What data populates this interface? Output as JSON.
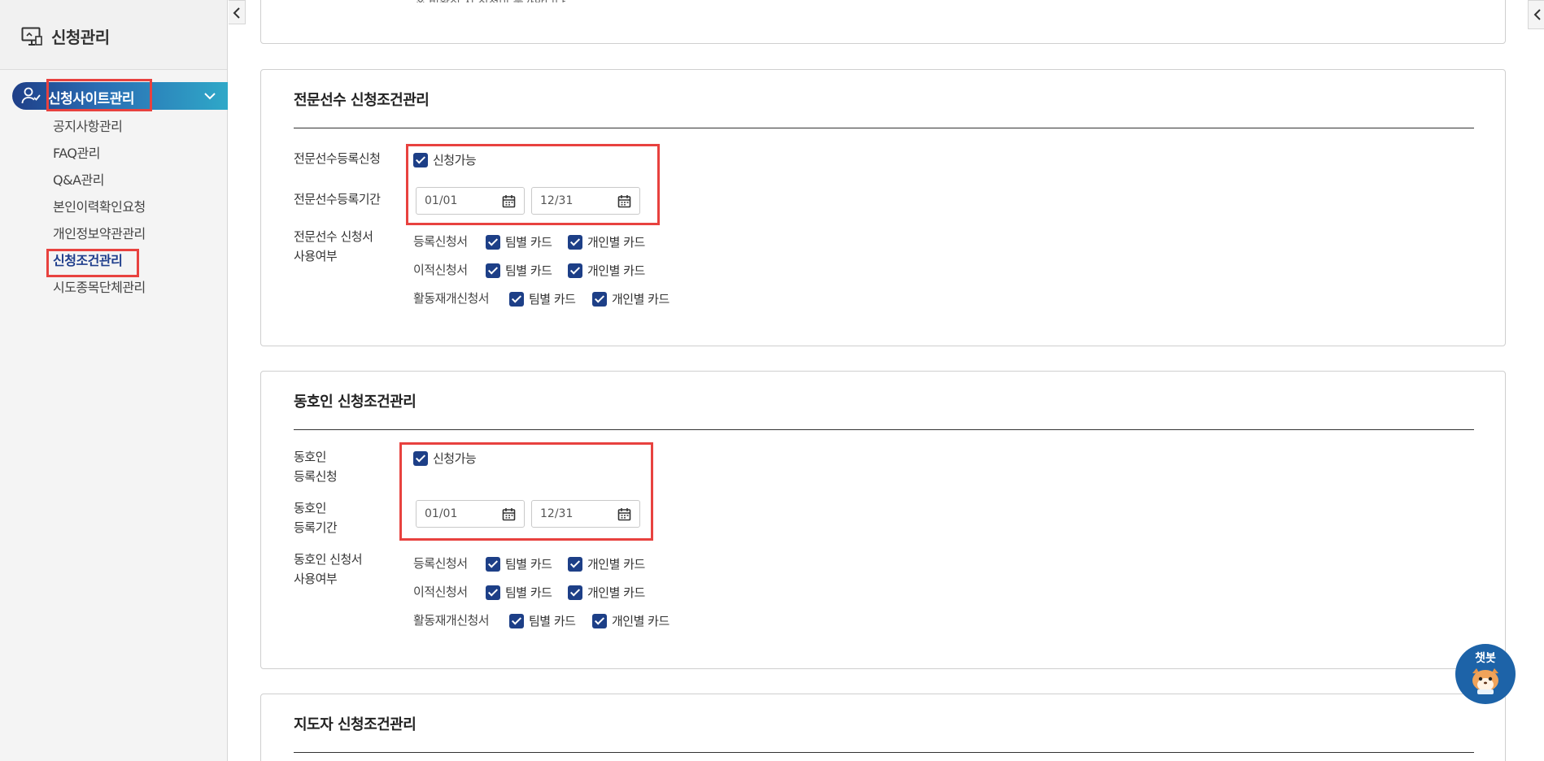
{
  "sidebar": {
    "title": "신청관리",
    "active_section": "신청사이트관리",
    "items": [
      {
        "label": "공지사항관리"
      },
      {
        "label": "FAQ관리"
      },
      {
        "label": "Q&A관리"
      },
      {
        "label": "본인이력확인요청"
      },
      {
        "label": "개인정보약관관리"
      },
      {
        "label": "신청조건관리"
      },
      {
        "label": "시도종목단체관리"
      }
    ]
  },
  "top_partial_text": "※ 비활성 시 신청이 불가합니다.",
  "sections": [
    {
      "title": "전문선수 신청조건관리",
      "reg_label": "전문선수등록신청",
      "available_label": "신청가능",
      "period_label": "전문선수등록기간",
      "date_from": "01/01",
      "date_to": "12/31",
      "usage_label_1": "전문선수 신청서",
      "usage_label_2": "사용여부",
      "forms": [
        {
          "name": "등록신청서",
          "team": "팀별 카드",
          "individual": "개인별 카드"
        },
        {
          "name": "이적신청서",
          "team": "팀별 카드",
          "individual": "개인별 카드"
        },
        {
          "name": "활동재개신청서",
          "team": "팀별 카드",
          "individual": "개인별 카드"
        }
      ]
    },
    {
      "title": "동호인 신청조건관리",
      "reg_label_1": "동호인",
      "reg_label_2": "등록신청",
      "available_label": "신청가능",
      "period_label_1": "동호인",
      "period_label_2": "등록기간",
      "date_from": "01/01",
      "date_to": "12/31",
      "usage_label_1": "동호인 신청서",
      "usage_label_2": "사용여부",
      "forms": [
        {
          "name": "등록신청서",
          "team": "팀별 카드",
          "individual": "개인별 카드"
        },
        {
          "name": "이적신청서",
          "team": "팀별 카드",
          "individual": "개인별 카드"
        },
        {
          "name": "활동재개신청서",
          "team": "팀별 카드",
          "individual": "개인별 카드"
        }
      ]
    },
    {
      "title": "지도자 신청조건관리"
    }
  ],
  "chatbot": {
    "label": "챗봇"
  },
  "colors": {
    "accent": "#1d3f87",
    "highlight": "#e8423f",
    "gradient_end": "#2fa8c8"
  }
}
